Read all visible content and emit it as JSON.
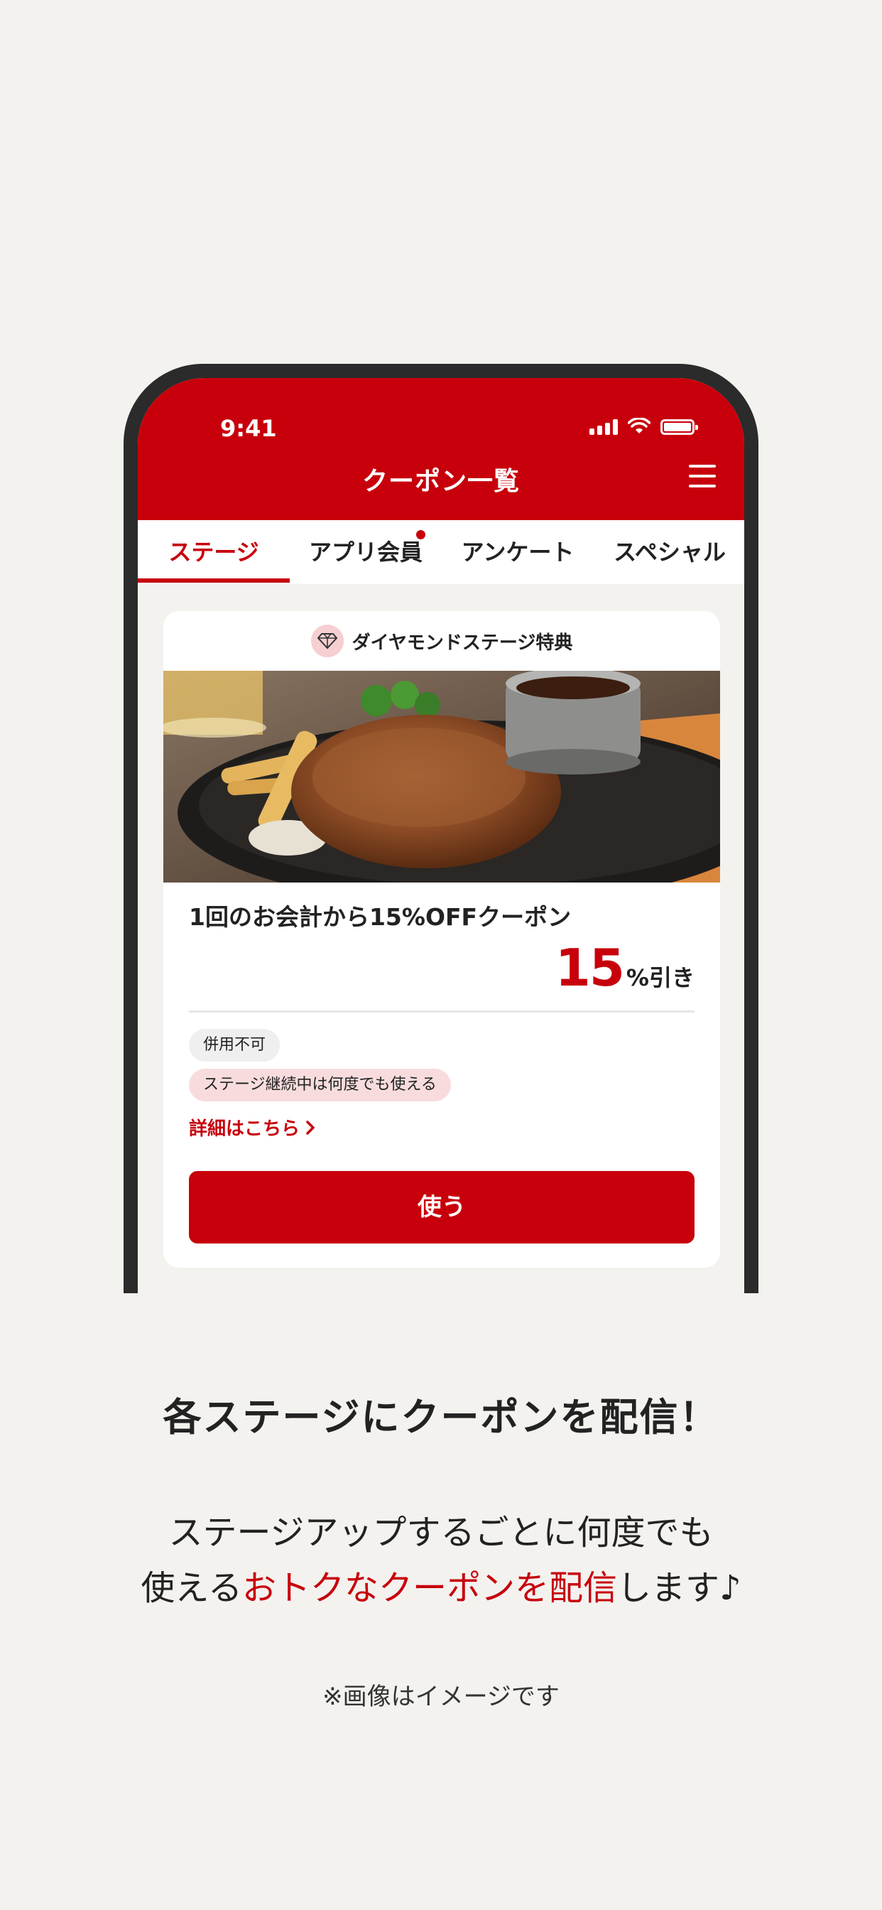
{
  "phone": {
    "status_time": "9:41",
    "app_title": "クーポン一覧",
    "tabs": [
      "ステージ",
      "アプリ会員",
      "アンケート",
      "スペシャル"
    ],
    "active_tab": "ステージ",
    "card": {
      "header_label": "ダイヤモンドステージ特典",
      "coupon_title": "1回のお会計から15%OFFクーポン",
      "discount_value": "15",
      "discount_unit": "%引き",
      "tags": [
        "併用不可",
        "ステージ継続中は何度でも使える"
      ],
      "detail_link": "詳細はこちら",
      "use_button": "使う"
    }
  },
  "promo": {
    "headline": "各ステージにクーポンを配信！",
    "desc_line1": "ステージアップするごとに何度でも",
    "desc_line2_prefix": "使える",
    "desc_line2_highlight": "おトクなクーポンを配信",
    "desc_line2_suffix": "します♪",
    "note": "※画像はイメージです"
  },
  "colors": {
    "brand_red": "#c7000b",
    "background": "#f3f2ef"
  }
}
